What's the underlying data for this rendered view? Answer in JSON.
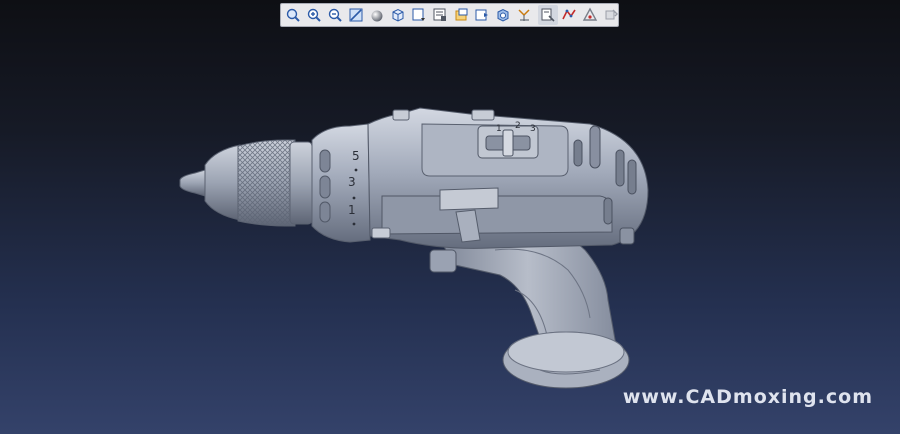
{
  "toolbar": {
    "tools": [
      {
        "name": "zoom-fit-icon",
        "color": "#2b5aa8"
      },
      {
        "name": "zoom-in-icon",
        "color": "#2b5aa8"
      },
      {
        "name": "zoom-out-icon",
        "color": "#2b5aa8"
      },
      {
        "name": "zoom-window-icon",
        "color": "#2b5aa8"
      },
      {
        "name": "shaded-sphere-icon",
        "color": "#7a7f8a"
      },
      {
        "name": "view-cube-icon",
        "color": "#2b5aa8"
      },
      {
        "name": "views-menu-icon",
        "color": "#2b5aa8"
      },
      {
        "name": "render-settings-icon",
        "color": "#505662"
      },
      {
        "name": "folder-view-icon",
        "color": "#c98a15"
      },
      {
        "name": "section-view-icon",
        "color": "#2b5aa8"
      },
      {
        "name": "transparency-icon",
        "color": "#2b5aa8"
      },
      {
        "name": "measure-coords-icon",
        "color": "#c97a10"
      },
      {
        "name": "probe-icon",
        "color": "#505662"
      },
      {
        "name": "curve-analysis-icon",
        "color": "#c42b2b"
      },
      {
        "name": "draft-analysis-icon",
        "color": "#7a7f8a"
      },
      {
        "name": "sketch-tool-icon",
        "color": "#9a9ea8"
      }
    ]
  },
  "model": {
    "name": "cordless-drill-model",
    "body_color": "#9aa2b2",
    "dial_numbers": [
      "5",
      "3",
      "1"
    ],
    "gear_numbers": [
      "1",
      "2",
      "3"
    ]
  },
  "watermark": {
    "text": "www.CADmoxing.com"
  },
  "theme": {
    "background_top": "#0e0f14",
    "background_bottom": "#34426a",
    "toolbar_bg": "#e9e9ec"
  }
}
